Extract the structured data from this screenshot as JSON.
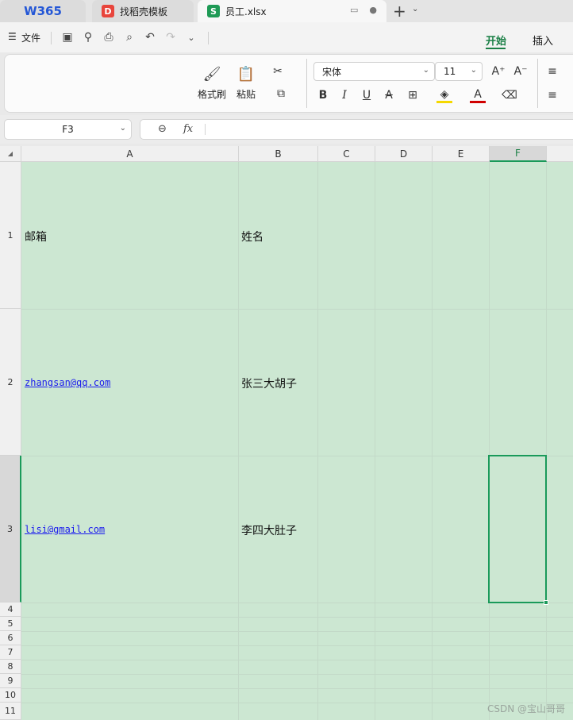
{
  "tabs": {
    "w365": "W365",
    "daoke": {
      "icon": "D",
      "label": "找稻壳模板"
    },
    "xlsx": {
      "icon": "S",
      "label": "员工.xlsx"
    }
  },
  "menu": {
    "file_label": "文件",
    "ribbon_tabs": [
      "开始",
      "插入"
    ]
  },
  "ribbon": {
    "format_painter": "格式刷",
    "paste": "粘贴",
    "font_name": "宋体",
    "font_size": "11"
  },
  "formula_bar": {
    "cell_ref": "F3",
    "fx": "fx",
    "content": ""
  },
  "sheet": {
    "columns": [
      "A",
      "B",
      "C",
      "D",
      "E",
      "F"
    ],
    "selected_column": "F",
    "selected_cell": "F3",
    "rows": [
      {
        "num": "1",
        "a": "邮箱",
        "b": "姓名"
      },
      {
        "num": "2",
        "a": "zhangsan@qq.com",
        "b": "张三大胡子"
      },
      {
        "num": "3",
        "a": "lisi@gmail.com",
        "b": "李四大肚子"
      }
    ],
    "empty_rows": [
      "4",
      "5",
      "6",
      "7",
      "8",
      "9",
      "10",
      "11"
    ]
  },
  "watermark": "CSDN @宝山哥哥",
  "colors": {
    "accent": "#1a7f45",
    "selection": "#1a9a5a",
    "grid_fill": "#cce7d2",
    "link": "#1a1aee"
  }
}
